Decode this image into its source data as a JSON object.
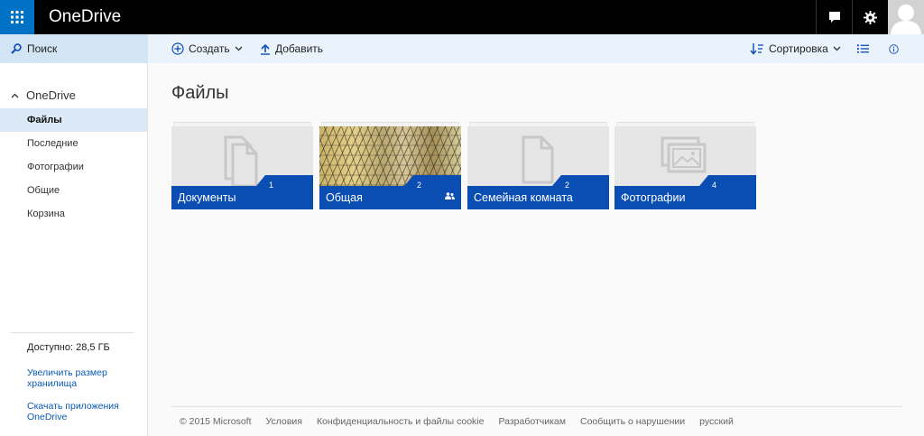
{
  "app": {
    "title": "OneDrive",
    "icons": {
      "waffle": "app-launcher-icon",
      "feedback": "feedback-icon",
      "settings": "gear-icon",
      "avatar": "user-avatar-icon"
    }
  },
  "toolbar": {
    "search_label": "Поиск",
    "create_label": "Создать",
    "upload_label": "Добавить",
    "sort_label": "Сортировка"
  },
  "sidebar": {
    "root_label": "OneDrive",
    "items": [
      {
        "label": "Файлы",
        "active": true
      },
      {
        "label": "Последние",
        "active": false
      },
      {
        "label": "Фотографии",
        "active": false
      },
      {
        "label": "Общие",
        "active": false
      },
      {
        "label": "Корзина",
        "active": false
      }
    ],
    "storage_text": "Доступно: 28,5 ГБ",
    "upgrade_link": "Увеличить размер хранилища",
    "apps_link": "Скачать приложения OneDrive"
  },
  "main": {
    "title": "Файлы"
  },
  "tiles": [
    {
      "name": "Документы",
      "count": "1",
      "icon": "documents-icon",
      "shared": false
    },
    {
      "name": "Общая",
      "count": "2",
      "icon": "photo-thumbnail",
      "shared": true
    },
    {
      "name": "Семейная комната",
      "count": "2",
      "icon": "document-icon",
      "shared": false
    },
    {
      "name": "Фотографии",
      "count": "4",
      "icon": "pictures-icon",
      "shared": false
    }
  ],
  "footer": {
    "copyright": "© 2015 Microsoft",
    "links": [
      "Условия",
      "Конфиденциальность и файлы cookie",
      "Разработчикам",
      "Сообщить о нарушении",
      "русский"
    ]
  },
  "colors": {
    "accent": "#0072c6",
    "tile_band": "#0a4db3",
    "link": "#0a59b5",
    "topbar": "#000000"
  }
}
